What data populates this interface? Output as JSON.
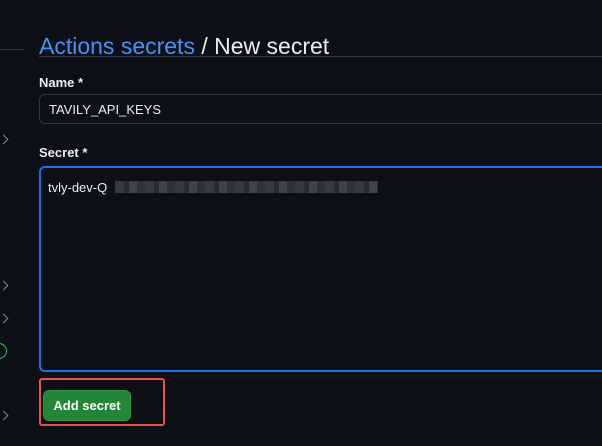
{
  "breadcrumb": {
    "parent_label": "Actions secrets",
    "separator": "/",
    "current_label": "New secret"
  },
  "form": {
    "name_label": "Name *",
    "name_value": "TAVILY_API_KEYS",
    "secret_label": "Secret *",
    "secret_value_visible": "tvly-dev-Q",
    "secret_value_redacted": true
  },
  "actions": {
    "submit_label": "Add secret"
  },
  "colors": {
    "background": "#0d1117",
    "link": "#4493f8",
    "primary_button": "#238636",
    "focus_border": "#1f6feb",
    "highlight_annotation": "#e5534b",
    "success_icon": "#3fb950"
  },
  "icons": {
    "sidebar_chevrons": [
      "chevron-icon",
      "chevron-icon",
      "chevron-icon",
      "chevron-icon"
    ],
    "sidebar_status": "check-circle-icon"
  }
}
